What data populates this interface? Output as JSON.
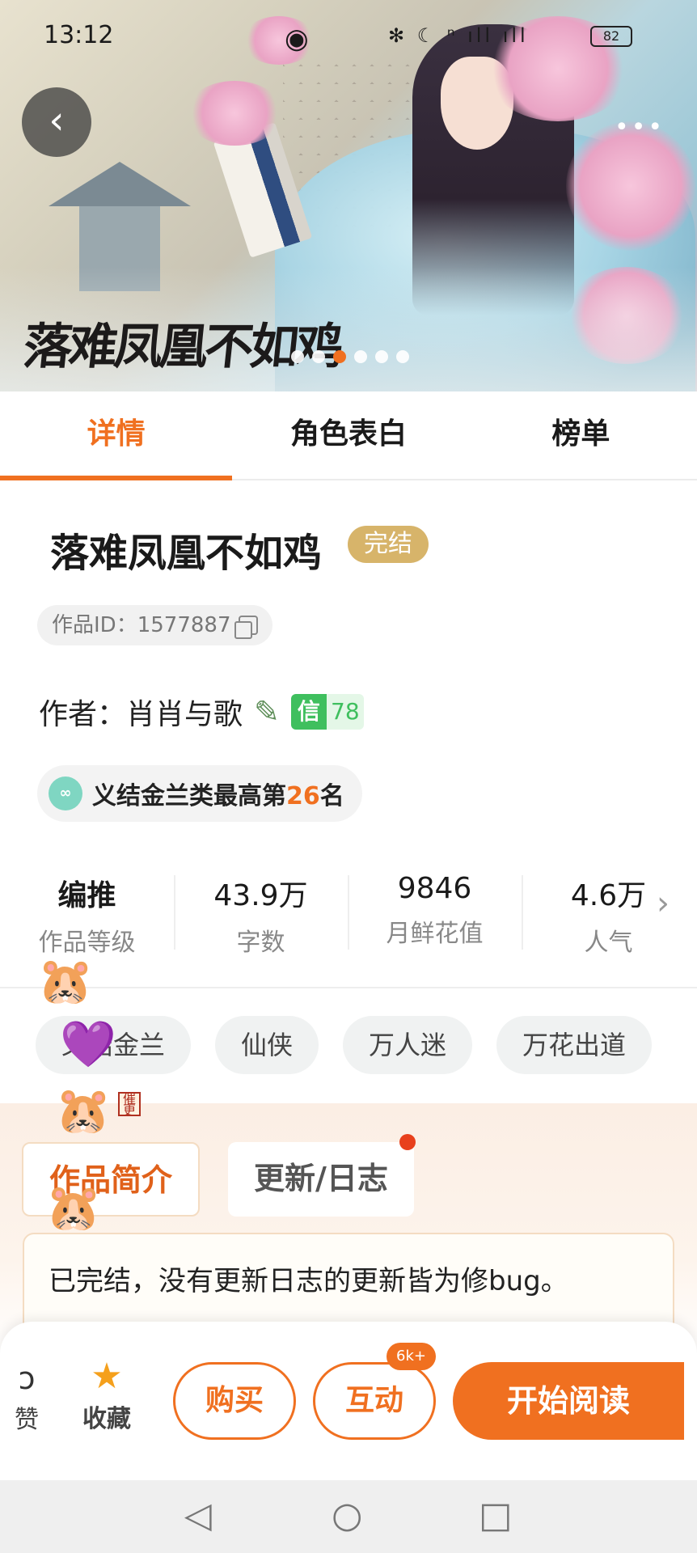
{
  "status_bar": {
    "time": "13:12",
    "icons": "✻ ☾ ⁿ ıll ıll",
    "battery": "82"
  },
  "hero": {
    "calligraphy_title": "落难凤凰不如鸡",
    "carousel_count": 6,
    "carousel_active_index": 2,
    "back_icon": "chevron-left-icon",
    "more_icon": "more-dots-icon"
  },
  "tabs": [
    {
      "label": "详情",
      "active": true
    },
    {
      "label": "角色表白",
      "active": false
    },
    {
      "label": "榜单",
      "active": false
    }
  ],
  "details": {
    "title": "落难凤凰不如鸡",
    "status_badge": "完结",
    "work_id_label": "作品ID：1577887",
    "author_label": "作者：肖肖与歌",
    "trust_label": "信",
    "trust_value": "78",
    "rank_prefix": "义结金兰类最高第",
    "rank_number": "26",
    "rank_suffix": "名"
  },
  "stats": [
    {
      "value": "编推",
      "label": "作品等级"
    },
    {
      "value": "43.9万",
      "label": "字数"
    },
    {
      "value": "9846",
      "label": "月鲜花值"
    },
    {
      "value": "4.6万",
      "label": "人气"
    }
  ],
  "tags": [
    "义结金兰",
    "仙侠",
    "万人迷",
    "万花出道"
  ],
  "intro": {
    "tab_active": "作品简介",
    "tab_inactive": "更新/日志",
    "text": "已完结，没有更新日志的更新皆为修bug。"
  },
  "bottom_bar": {
    "like_label": "赞",
    "favorite_label": "收藏",
    "buy_label": "购买",
    "interact_label": "互动",
    "interact_badge": "6k+",
    "read_label": "开始阅读"
  },
  "colors": {
    "accent": "#f07020",
    "done_badge": "#d7b46a",
    "trust_green": "#3fbf5e"
  }
}
